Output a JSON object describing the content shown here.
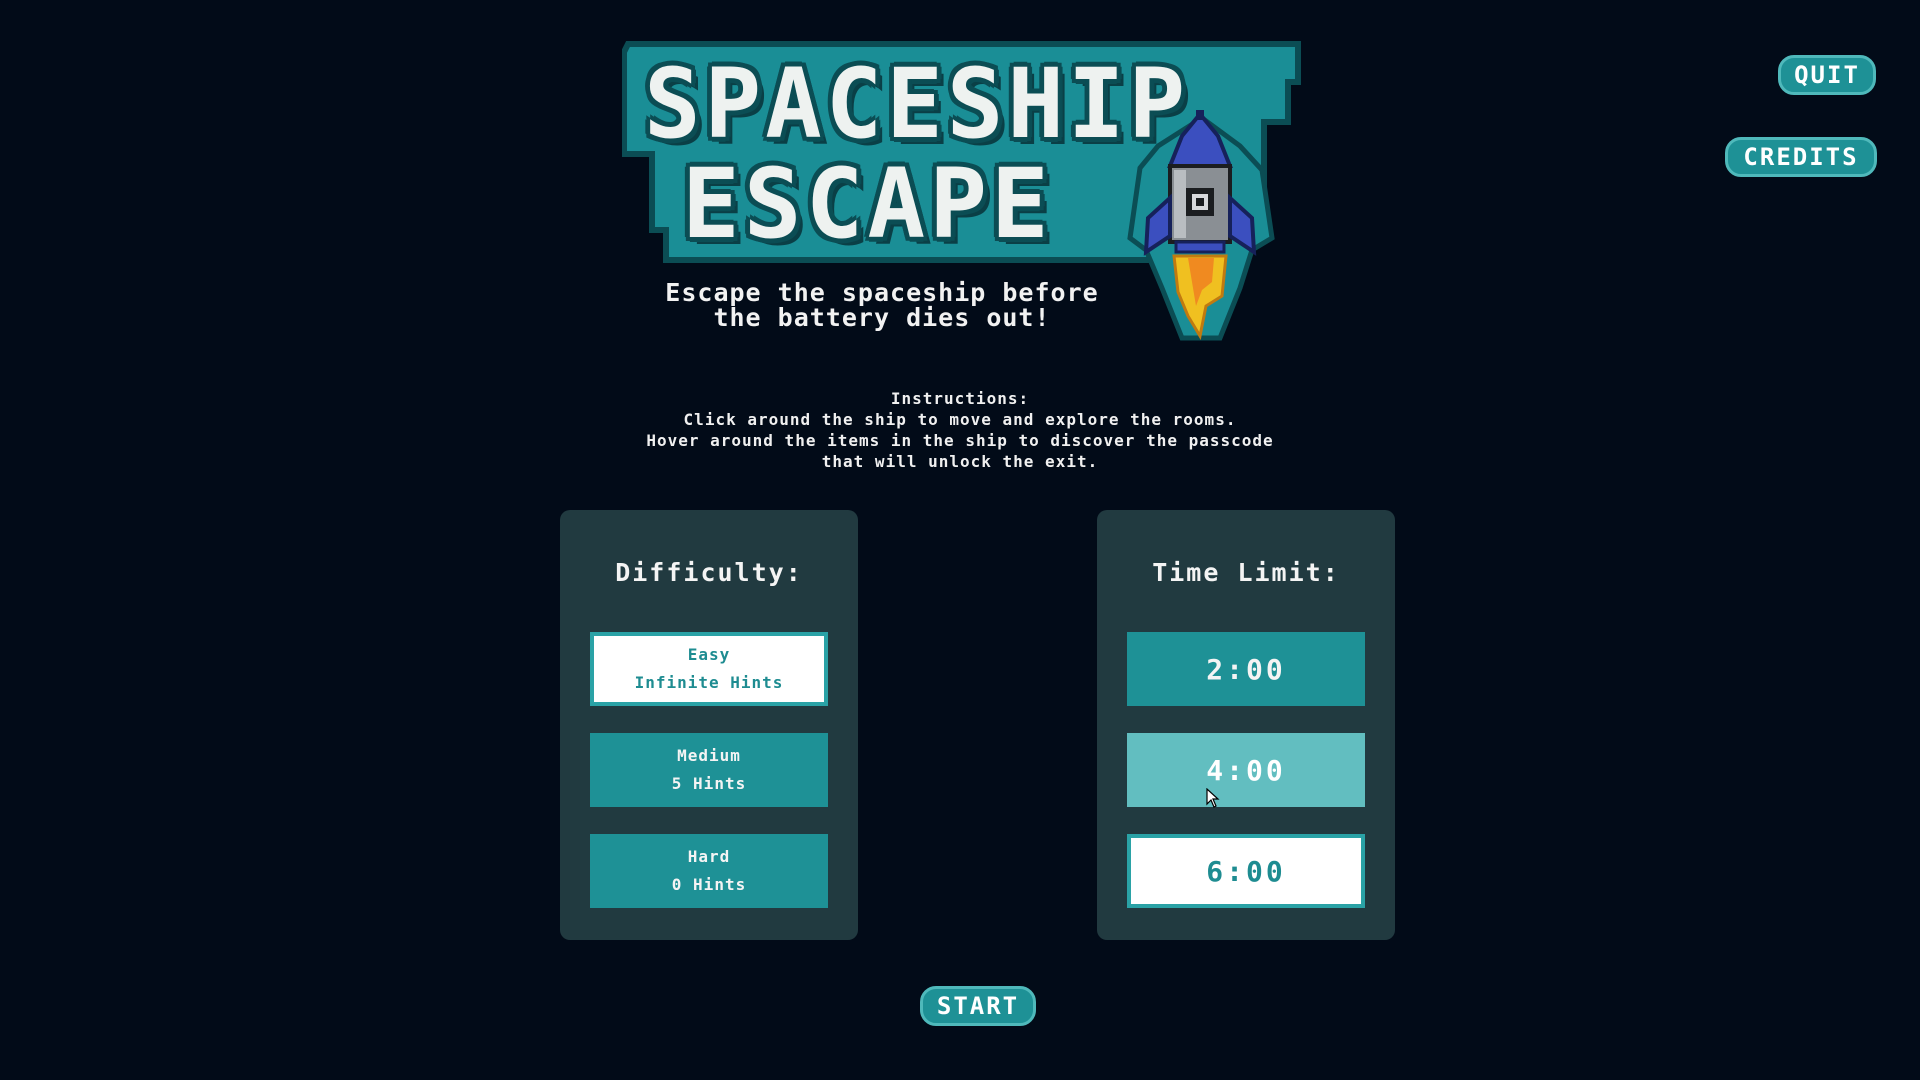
{
  "game": {
    "title_line_1": "SPACESHIP",
    "title_line_2": "ESCAPE",
    "subtitle_line_1": "Escape the spaceship before",
    "subtitle_line_2": "the battery dies out!"
  },
  "menu": {
    "quit_label": "QUIT",
    "credits_label": "CREDITS",
    "start_label": "START"
  },
  "instructions": {
    "heading": "Instructions:",
    "line_1": "Click around the ship to move and explore the rooms.",
    "line_2": "Hover around the items in the ship to discover the passcode",
    "line_3": "that will unlock the exit."
  },
  "difficulty": {
    "title": "Difficulty:",
    "options": [
      {
        "name": "Easy",
        "hints": "Infinite Hints",
        "state": "selected"
      },
      {
        "name": "Medium",
        "hints": "5 Hints",
        "state": "normal"
      },
      {
        "name": "Hard",
        "hints": "0 Hints",
        "state": "normal"
      }
    ]
  },
  "time_limit": {
    "title": "Time Limit:",
    "options": [
      {
        "label": "2:00",
        "state": "normal"
      },
      {
        "label": "4:00",
        "state": "hover"
      },
      {
        "label": "6:00",
        "state": "selected"
      }
    ]
  },
  "icons": {
    "logo": "rocket-icon",
    "cursor": "mouse-pointer-icon"
  },
  "colors": {
    "background": "#020b18",
    "panel": "#213a40",
    "button_teal": "#1e9196",
    "button_hover": "#62bec0",
    "selected_fill": "#ffffff",
    "logo_teal": "#1a8e96",
    "rocket_blue": "#3b4fbf",
    "flame": "#f0c020"
  }
}
